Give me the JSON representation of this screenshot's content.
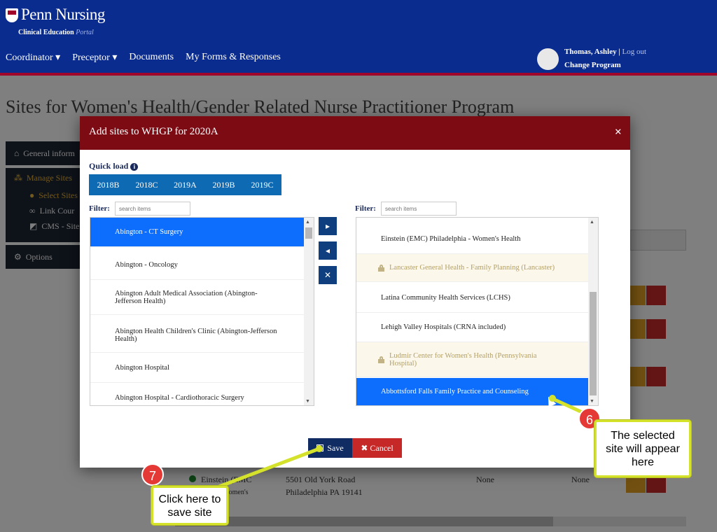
{
  "header": {
    "logo_main": "Penn Nursing",
    "logo_sub": "Clinical Education",
    "logo_sub_italic": "Portal",
    "nav": [
      "Coordinator ▾",
      "Preceptor ▾",
      "Documents",
      "My Forms & Responses"
    ],
    "user_name": "Thomas, Ashley",
    "logout": "Log out",
    "change_program": "Change Program"
  },
  "page_title": "Sites for Women's Health/Gender Related Nurse Practitioner Program",
  "sidebar": {
    "general": "General inform",
    "manage_sites": "Manage Sites",
    "select_sites": "Select Sites",
    "link_courses": "Link Cour",
    "cms": "CMS - Site",
    "options": "Options"
  },
  "background_row": {
    "site": "Einstein (EMC",
    "site2": "Women's",
    "address1": "5501 Old York Road",
    "address2": "Philadelphia PA 19141",
    "col1": "None",
    "col2": "None"
  },
  "modal": {
    "title": "Add sites to WHGP for 2020A",
    "close": "×",
    "quick_load_label": "Quick load",
    "quick_load": [
      "2018B",
      "2018C",
      "2019A",
      "2019B",
      "2019C"
    ],
    "filter_label": "Filter:",
    "filter_placeholder": "search items",
    "left_items": [
      "Abington - CT Surgery",
      "Abington - Oncology",
      "Abington Adult Medical Association (Abington-Jefferson Health)",
      "Abington Health Children's Clinic (Abington-Jefferson Health)",
      "Abington Hospital",
      "Abington Hospital - Cardiothoracic Surgery"
    ],
    "right_items": [
      "Einstein (EMC) Philadelphia - Women's Health",
      "Lancaster General Health - Family Planning (Lancaster)",
      "Latina Community Health Services (LCHS)",
      "Lehigh Valley Hospitals (CRNA included)",
      "Ludmir Center for Women's Health (Pennsylvania Hospital)",
      "Abbottsford Falls Family Practice and Counseling"
    ],
    "move_right": "▸",
    "move_left": "◂",
    "remove": "✕",
    "save": "Save",
    "cancel": "✖ Cancel"
  },
  "callouts": {
    "badge6": "6",
    "text6": "The selected site will appear here",
    "badge7": "7",
    "text7": "Click here to save site"
  },
  "colors": {
    "header_bg": "#0b2c8f",
    "modal_header": "#7d0b14",
    "selected": "#0d6efd",
    "callout_border": "#d4e22b"
  }
}
